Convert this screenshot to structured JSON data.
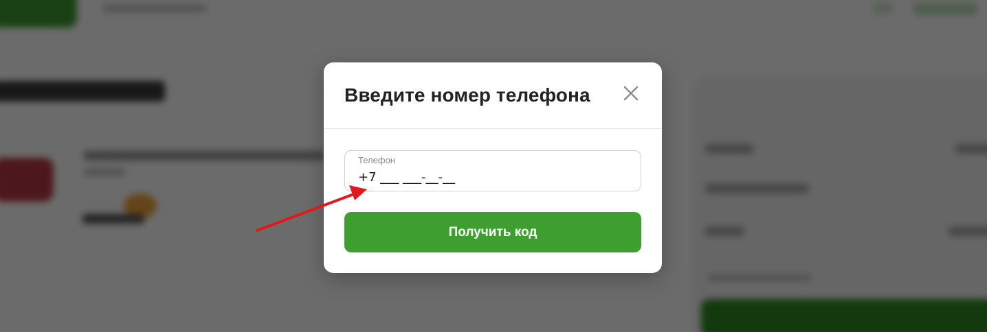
{
  "modal": {
    "title": "Введите номер телефона",
    "close_icon": "close-icon",
    "phone_field": {
      "label": "Телефон",
      "value": "+7 ___ ___-__-__"
    },
    "submit_label": "Получить код"
  },
  "annotation": {
    "arrow_icon": "red-arrow-icon",
    "arrow_color": "#e01a1a"
  },
  "colors": {
    "accent": "#3e9e30",
    "overlay": "rgba(0,0,0,0.58)"
  }
}
